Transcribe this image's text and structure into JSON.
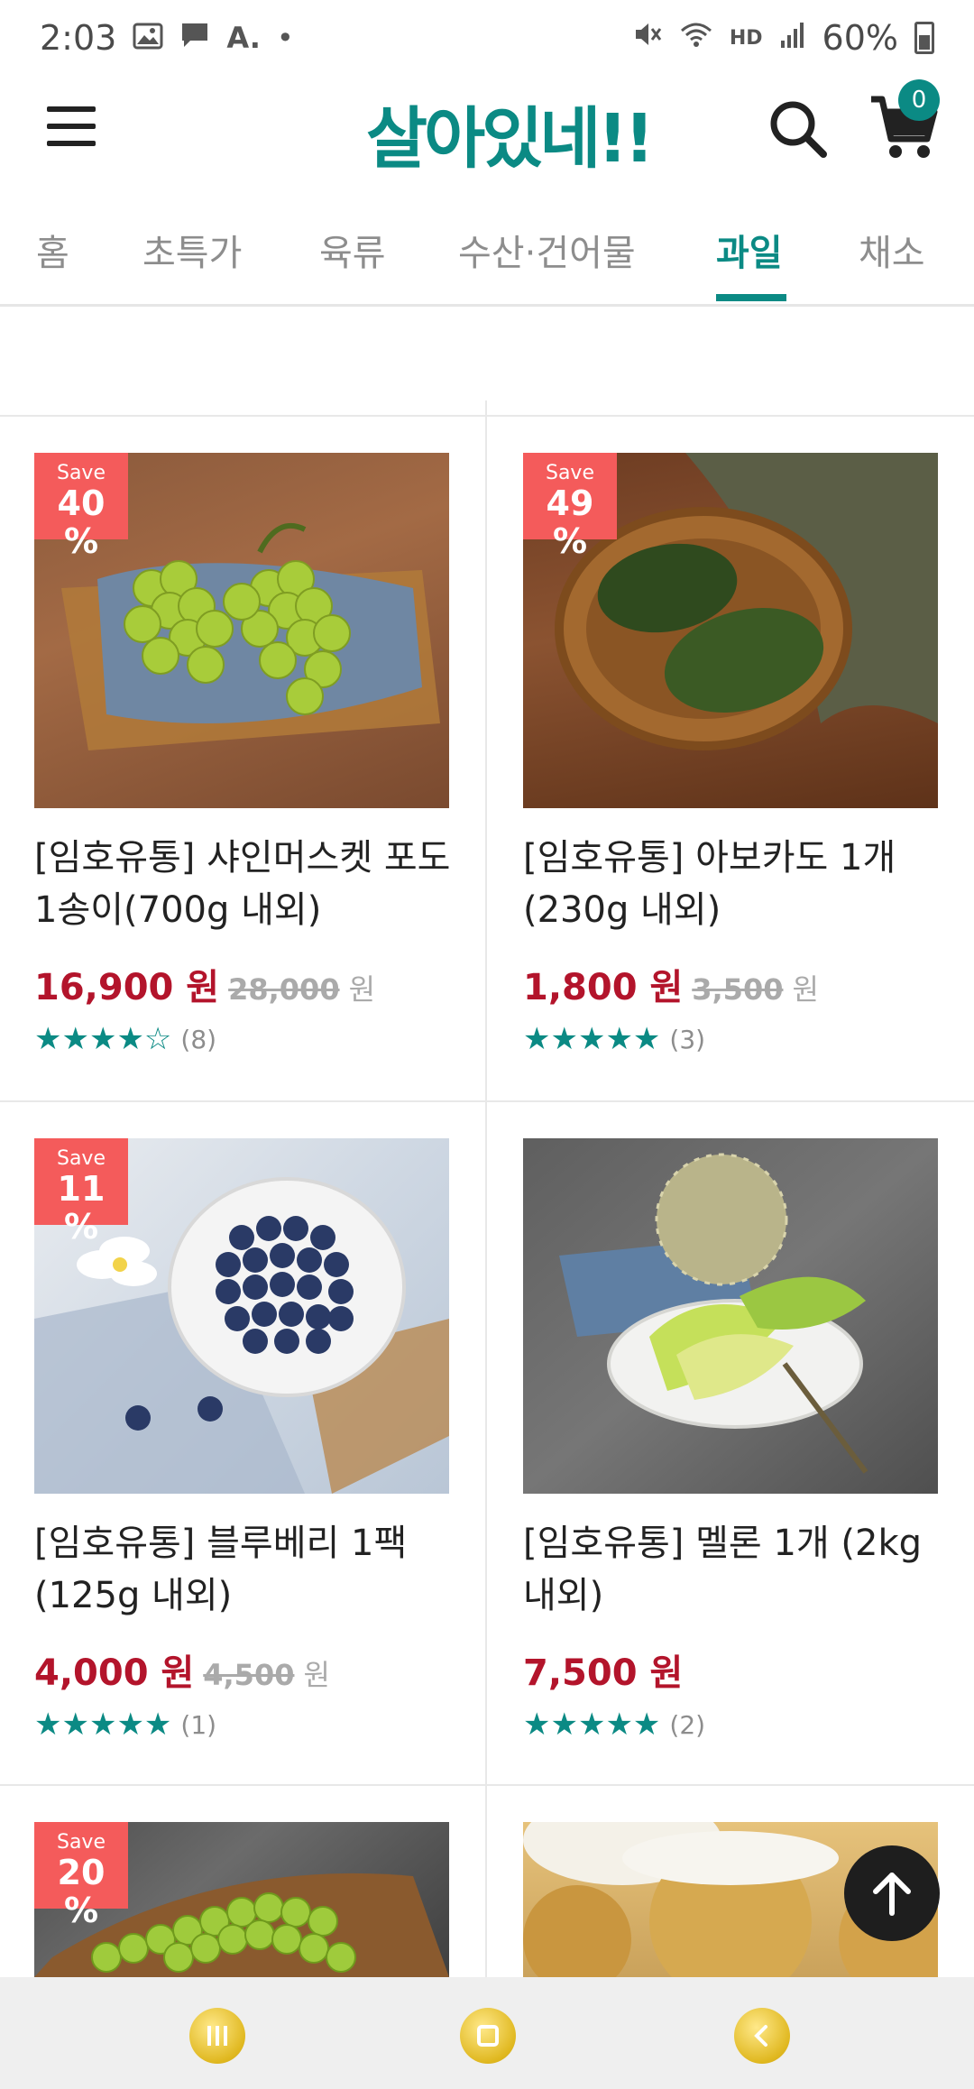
{
  "status_bar": {
    "time": "2:03",
    "left_icons": [
      "image-icon",
      "message-icon",
      "font-app-icon",
      "dot-icon"
    ],
    "font_app_glyph": "A.",
    "dot_glyph": "•",
    "right_icons": [
      "mute-icon",
      "wifi-icon",
      "hd-voice-icon",
      "signal-icon",
      "battery-icon"
    ],
    "hd_voice_label": "HD",
    "battery_percent": "60%"
  },
  "header": {
    "logo_text": "살아있네!!",
    "cart_count": "0",
    "brand_color": "#0b8a84"
  },
  "nav_tabs": [
    {
      "label": "홈",
      "active": false
    },
    {
      "label": "초특가",
      "active": false
    },
    {
      "label": "육류",
      "active": false
    },
    {
      "label": "수산·건어물",
      "active": false
    },
    {
      "label": "과일",
      "active": true
    },
    {
      "label": "채소",
      "active": false
    }
  ],
  "products": [
    {
      "badge_label": "Save",
      "badge_percent": "40 %",
      "title": "[임호유통] 샤인머스켓 포도 1송이(700g 내외)",
      "price": "16,900 원",
      "original_price": "28,000",
      "original_unit": "원",
      "stars": "★★★★☆",
      "rating_value": 4.5,
      "review_count": "(8)",
      "photo_icon": "green-grapes-photo"
    },
    {
      "badge_label": "Save",
      "badge_percent": "49 %",
      "title": "[임호유통] 아보카도 1개(230g 내외)",
      "price": "1,800 원",
      "original_price": "3,500",
      "original_unit": "원",
      "stars": "★★★★★",
      "rating_value": 5,
      "review_count": "(3)",
      "photo_icon": "avocado-photo"
    },
    {
      "badge_label": "Save",
      "badge_percent": "11 %",
      "title": "[임호유통] 블루베리 1팩(125g 내외)",
      "price": "4,000 원",
      "original_price": "4,500",
      "original_unit": "원",
      "stars": "★★★★★",
      "rating_value": 5,
      "review_count": "(1)",
      "photo_icon": "blueberry-photo"
    },
    {
      "title": "[임호유통] 멜론 1개 (2kg 내외)",
      "price": "7,500 원",
      "stars": "★★★★★",
      "rating_value": 5,
      "review_count": "(2)",
      "photo_icon": "melon-photo"
    },
    {
      "badge_label": "Save",
      "badge_percent": "20 %",
      "photo_icon": "green-grapes-basket-photo"
    },
    {
      "photo_icon": "pear-photo"
    }
  ],
  "colors": {
    "accent": "#0b8a84",
    "price_red": "#b3142b",
    "badge_red": "#f45b5b"
  }
}
